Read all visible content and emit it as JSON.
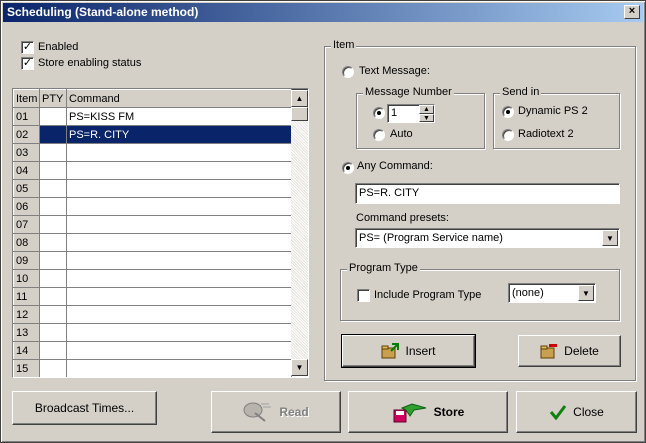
{
  "window": {
    "title": "Scheduling (Stand-alone method)",
    "close_glyph": "×"
  },
  "options": {
    "enabled_label": "Enabled",
    "store_enabling_label": "Store enabling status"
  },
  "table": {
    "headers": [
      "Item",
      "PTY",
      "Command"
    ],
    "rows": [
      {
        "item": "01",
        "pty": "",
        "command": "PS=KISS FM"
      },
      {
        "item": "02",
        "pty": "",
        "command": "PS=R. CITY"
      },
      {
        "item": "03",
        "pty": "",
        "command": ""
      },
      {
        "item": "04",
        "pty": "",
        "command": ""
      },
      {
        "item": "05",
        "pty": "",
        "command": ""
      },
      {
        "item": "06",
        "pty": "",
        "command": ""
      },
      {
        "item": "07",
        "pty": "",
        "command": ""
      },
      {
        "item": "08",
        "pty": "",
        "command": ""
      },
      {
        "item": "09",
        "pty": "",
        "command": ""
      },
      {
        "item": "10",
        "pty": "",
        "command": ""
      },
      {
        "item": "11",
        "pty": "",
        "command": ""
      },
      {
        "item": "12",
        "pty": "",
        "command": ""
      },
      {
        "item": "13",
        "pty": "",
        "command": ""
      },
      {
        "item": "14",
        "pty": "",
        "command": ""
      },
      {
        "item": "15",
        "pty": "",
        "command": ""
      }
    ]
  },
  "item_panel": {
    "label": "Item",
    "text_message_label": "Text Message:",
    "message_number": {
      "label": "Message Number",
      "value": "1",
      "auto_label": "Auto"
    },
    "send_in": {
      "label": "Send in",
      "dynamic_ps_label": "Dynamic PS 2",
      "radiotext_label": "Radiotext 2"
    },
    "any_command_label": "Any Command:",
    "any_command_value": "PS=R. CITY",
    "command_presets_label": "Command presets:",
    "command_presets_value": "PS= (Program Service name)",
    "program_type": {
      "label": "Program Type",
      "include_label": "Include Program Type",
      "value": "(none)"
    },
    "insert_label": "Insert",
    "delete_label": "Delete"
  },
  "footer": {
    "broadcast_times_label": "Broadcast Times...",
    "read_label": "Read",
    "store_label": "Store",
    "close_label": "Close"
  }
}
